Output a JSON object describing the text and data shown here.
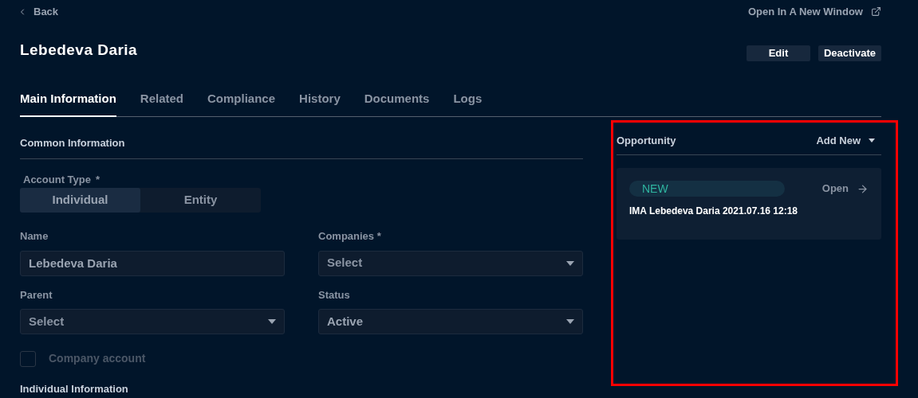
{
  "header": {
    "back": "Back",
    "open_new_window": "Open In A New Window",
    "title": "Lebedeva Daria",
    "actions": [
      "Edit",
      "Deactivate"
    ]
  },
  "tabs": [
    {
      "label": "Main Information",
      "selected": true
    },
    {
      "label": "Related",
      "selected": false
    },
    {
      "label": "Compliance",
      "selected": false
    },
    {
      "label": "History",
      "selected": false
    },
    {
      "label": "Documents",
      "selected": false
    },
    {
      "label": "Logs",
      "selected": false
    }
  ],
  "common_information": {
    "title": "Common Information",
    "account_type": {
      "label": "Account Type",
      "required_mark": "*",
      "options": [
        {
          "label": "Individual",
          "selected": true
        },
        {
          "label": "Entity",
          "selected": false
        }
      ]
    },
    "fields": [
      {
        "label": "Name",
        "kind": "input",
        "value": "Lebedeva Daria"
      },
      {
        "label": "Companies *",
        "kind": "select",
        "placeholder": "Select"
      },
      {
        "label": "Parent",
        "kind": "select",
        "placeholder": "Select"
      },
      {
        "label": "Status",
        "kind": "select",
        "value": "Active"
      }
    ],
    "company_account": {
      "label": "Company account",
      "checked": false,
      "disabled": true
    }
  },
  "individual_information": {
    "title": "Individual Information"
  },
  "opportunity": {
    "title": "Opportunity",
    "add_new": "Add New",
    "highlighted": true,
    "cards": [
      {
        "status": "NEW",
        "open": "Open",
        "name": "IMA Lebedeva Daria 2021.07.16 12:18"
      }
    ]
  }
}
